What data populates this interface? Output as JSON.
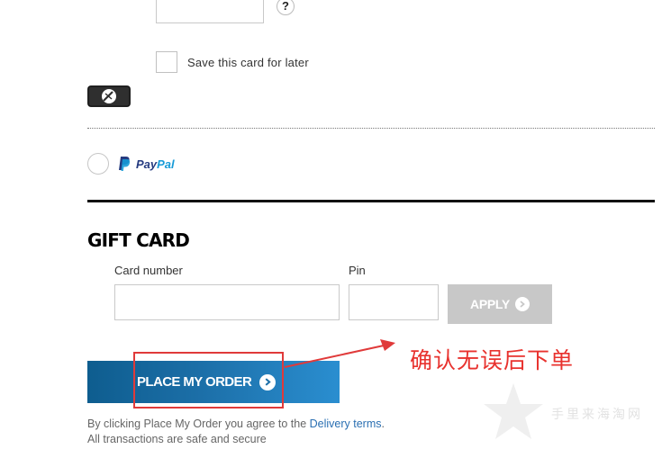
{
  "payment": {
    "cvv_help_icon": "?",
    "save_card_label": "Save this card for later",
    "card_logo_icon": "card-brand-icon",
    "paypal": {
      "pay": "Pay",
      "pal": "Pal"
    }
  },
  "gift_card": {
    "title": "GIFT CARD",
    "card_number_label": "Card number",
    "card_number_value": "",
    "pin_label": "Pin",
    "pin_value": "",
    "apply_label": "APPLY"
  },
  "order": {
    "place_order_label": "PLACE MY ORDER",
    "disclaimer_prefix": "By clicking Place My Order you agree to the ",
    "delivery_terms_link": "Delivery terms",
    "disclaimer_suffix": ".",
    "secure_note": "All transactions are safe and secure"
  },
  "annotation": {
    "text": "确认无误后下单",
    "color": "#e8322e"
  },
  "watermark": {
    "text": "手里来海淘网"
  },
  "colors": {
    "place_order_blue": "#1c6fa8",
    "apply_disabled": "#c8c8c8",
    "link_blue": "#2a6fb2",
    "paypal_dark": "#253b80",
    "paypal_light": "#179bd7"
  }
}
